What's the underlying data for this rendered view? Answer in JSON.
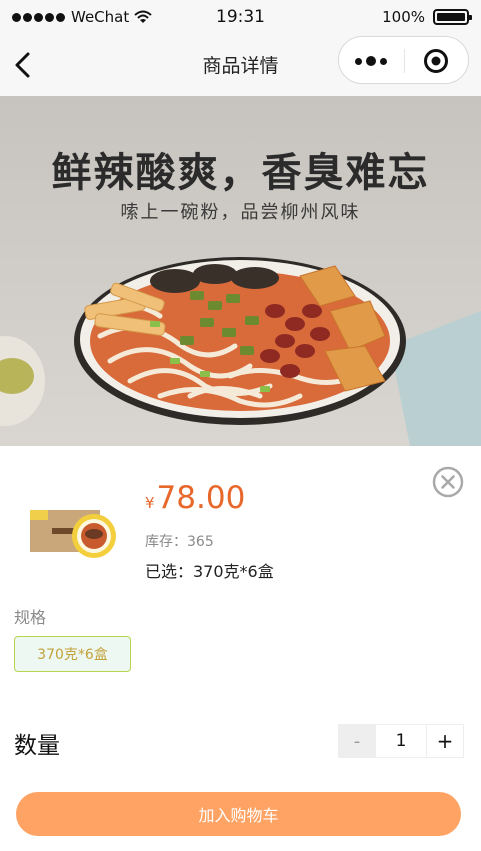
{
  "status_bar": {
    "carrier": "WeChat",
    "time": "19:31",
    "battery": "100%"
  },
  "nav": {
    "title": "商品详情"
  },
  "banner": {
    "title": "鲜辣酸爽，香臭难忘",
    "subtitle": "嗦上一碗粉，品尝柳州风味"
  },
  "product": {
    "currency_symbol": "¥",
    "price": "78.00",
    "stock": "库存：365",
    "selected": "已选：370克*6盒"
  },
  "spec": {
    "label": "规格",
    "options": [
      "370克*6盒"
    ]
  },
  "quantity": {
    "label": "数量",
    "value": "1",
    "minus": "-",
    "plus": "+"
  },
  "cart": {
    "button_label": "加入购物车"
  },
  "colors": {
    "price": "#e8672b",
    "cart_button": "#ffa364",
    "spec_border": "#b9d44e",
    "spec_background": "#eef8f3"
  },
  "icons": [
    "wifi-icon",
    "battery-icon",
    "back-icon",
    "more-icon",
    "target-icon",
    "close-icon"
  ]
}
